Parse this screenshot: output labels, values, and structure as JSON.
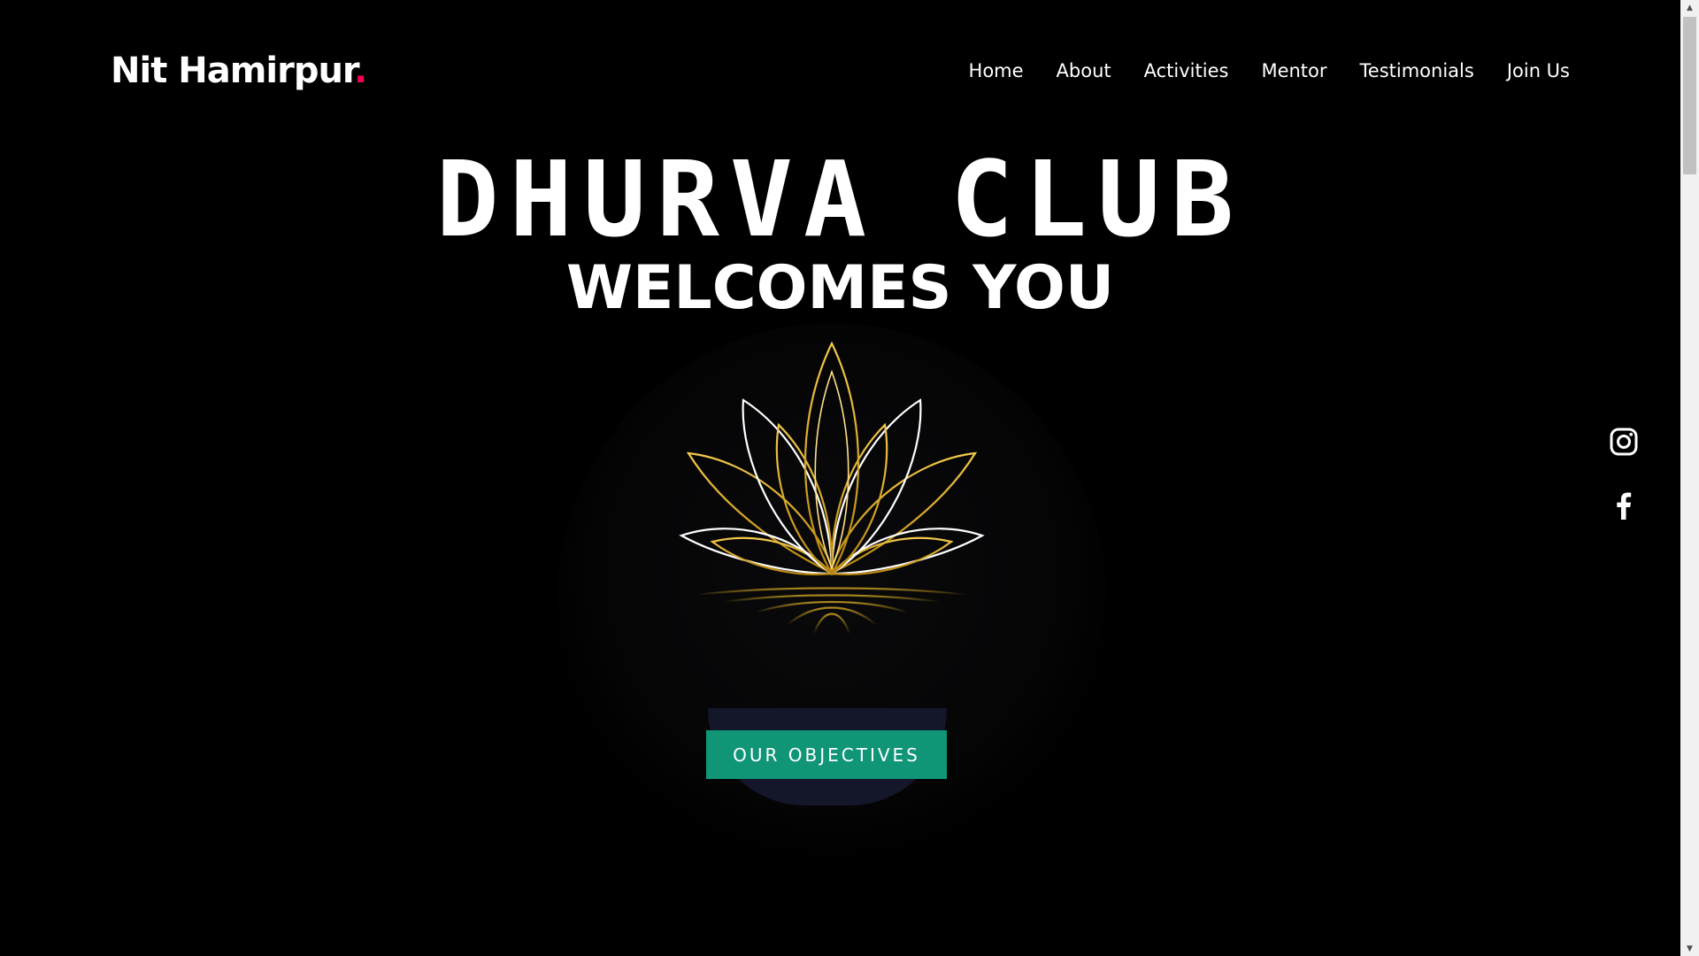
{
  "header": {
    "brand": "Nit Hamirpur",
    "brand_dot": ".",
    "nav": [
      "Home",
      "About",
      "Activities",
      "Mentor",
      "Testimonials",
      "Join Us"
    ]
  },
  "hero": {
    "title": "DHURVA CLUB",
    "subtitle": "WELCOMES YOU",
    "cta_label": "OUR OBJECTIVES"
  },
  "social": [
    "instagram-icon",
    "facebook-icon"
  ],
  "colors": {
    "background": "#000000",
    "brand_dot": "#f50057",
    "cta": "#109577",
    "lotus_gold": "#d8a620",
    "lotus_white": "#ffffff"
  }
}
